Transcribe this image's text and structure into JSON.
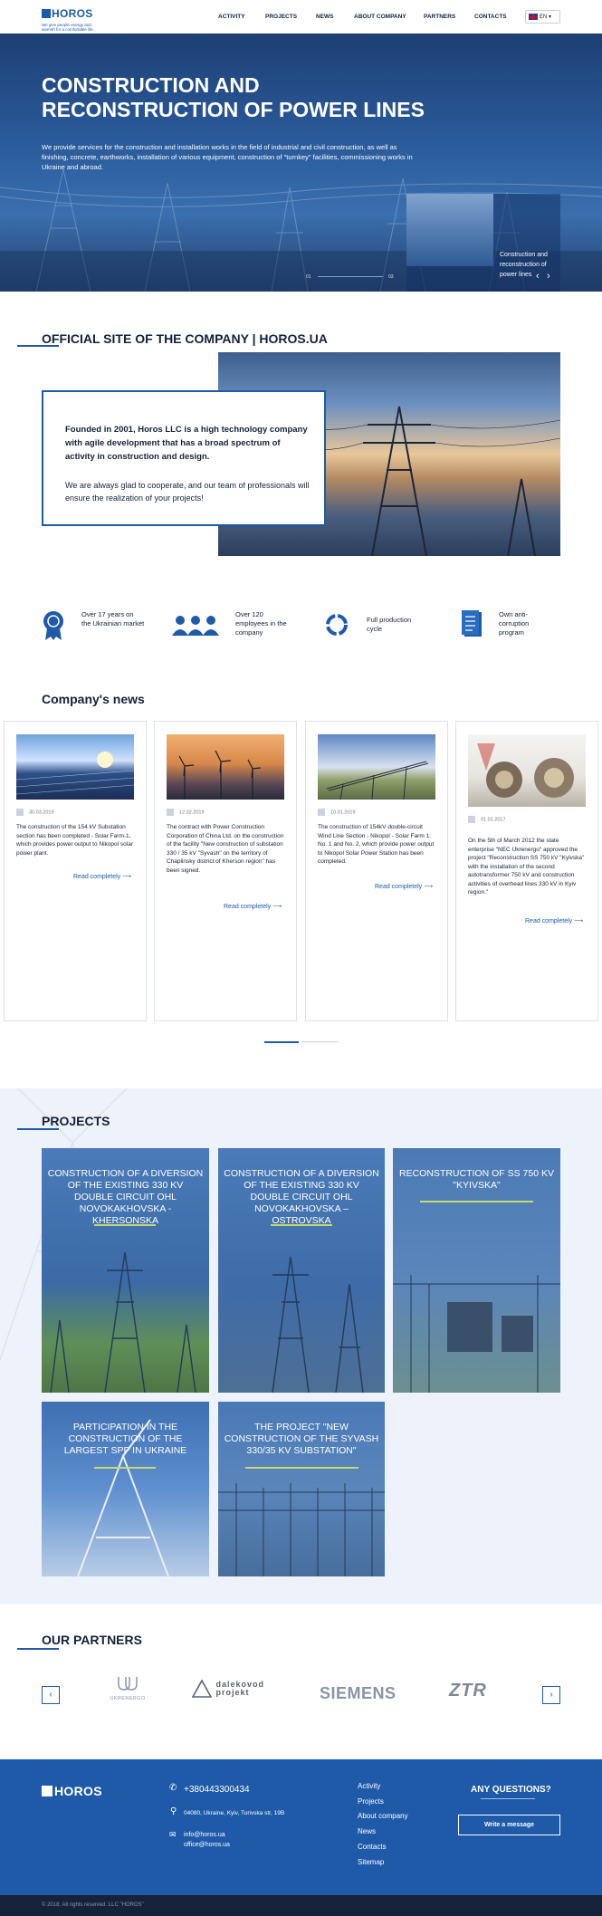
{
  "header": {
    "logo_text": "HOROS",
    "tagline": "We give people energy and warmth for a comfortable life",
    "nav": [
      "ACTIVITY",
      "PROJECTS",
      "NEWS",
      "ABOUT COMPANY",
      "PARTNERS",
      "CONTACTS"
    ],
    "lang": "EN"
  },
  "hero": {
    "title": "CONSTRUCTION AND RECONSTRUCTION OF POWER LINES",
    "text": "We provide services for the construction and installation works in the field of industrial and civil construction, as well as finishing, concrete, earthworks, installation of various equipment, construction of \"turnkey\" facilities, commissioning works in Ukraine and abroad.",
    "card_label": "Construction and reconstruction of power lines",
    "counter_current": "01",
    "counter_total": "03"
  },
  "about": {
    "title": "OFFICIAL SITE OF THE COMPANY | HOROS.UA",
    "bold": "Founded in 2001, Horos LLC is a high technology company with agile development that has a broad spectrum of activity in construction and design.",
    "regular": "We are always glad to cooperate, and our team of professionals will ensure the realization of your projects!"
  },
  "features": [
    {
      "icon": "medal-icon",
      "text": "Over 17 years on the Ukrainian market"
    },
    {
      "icon": "team-icon",
      "text": "Over 120 employees in the company"
    },
    {
      "icon": "cycle-icon",
      "text": "Full production cycle"
    },
    {
      "icon": "document-icon",
      "text": "Own anti-corruption program"
    }
  ],
  "news": {
    "title": "Company's news",
    "read_more": "Read completely",
    "items": [
      {
        "date": "30.03.2019",
        "text": "The construction of the 154 kV Substation section has been completed - Solar Farm-1, which provides power output to Nikopol solar power plant."
      },
      {
        "date": "12.02.2019",
        "text": "The contract with Power Construction Corporation of China Ltd. on the construction of the facility \"New construction of substation 330 / 35 kV \"Syvash\" on the territory of Chaplinsky district of Kherson region\" has been signed."
      },
      {
        "date": "10.01.2019",
        "text": "The construction of 154kV double-circuit Wind Line Section - Nikopol - Solar Farm 1: No. 1 and No. 2, which provide power output to Nikopol Solar Power Station has been completed."
      },
      {
        "date": "01.01.2017",
        "text": "On the 5th of March 2012 the state enterprise \"NEC Ukrenergo\" approved the project \"Reconstruction SS 750 kV \"Kyivska\" with the installation of the second autotransformer 750 kV and construction activities of overhead lines 330 kV in Kyiv region.\""
      }
    ]
  },
  "projects": {
    "title": "PROJECTS",
    "items": [
      "CONSTRUCTION OF A DIVERSION OF THE EXISTING 330 KV DOUBLE CIRCUIT OHL NOVOKAKHOVSKA - KHERSONSKA",
      "CONSTRUCTION OF A DIVERSION OF THE EXISTING 330 KV DOUBLE CIRCUIT OHL NOVOKAKHOVSKA – OSTROVSKA",
      "RECONSTRUCTION OF SS 750 KV \"KYIVSKA\"",
      "PARTICIPATION IN THE CONSTRUCTION OF THE LARGEST SPP IN UKRAINE",
      "THE PROJECT \"NEW CONSTRUCTION OF THE SYVASH 330/35 KV SUBSTATION\""
    ]
  },
  "partners": {
    "title": "OUR PARTNERS",
    "items": [
      "UKRENERGO",
      "DALEKOVOD PROJEKT",
      "SIEMENS",
      "ZTR"
    ]
  },
  "footer": {
    "logo_text": "HOROS",
    "phone": "+380443300434",
    "address": "04080, Ukraine, Kyiv, Turivska str, 19B",
    "email1": "info@horos.ua",
    "email2": "office@horos.ua",
    "links": [
      "Activity",
      "Projects",
      "About company",
      "News",
      "Contacts",
      "Sitemap"
    ],
    "question": "ANY QUESTIONS?",
    "button": "Write a message",
    "copyright": "© 2018. All rights reserved. LLC \"HOROS\""
  },
  "colors": {
    "brand": "#1e5aa8",
    "dark": "#16213a",
    "accent_line": "#c8d96a"
  }
}
